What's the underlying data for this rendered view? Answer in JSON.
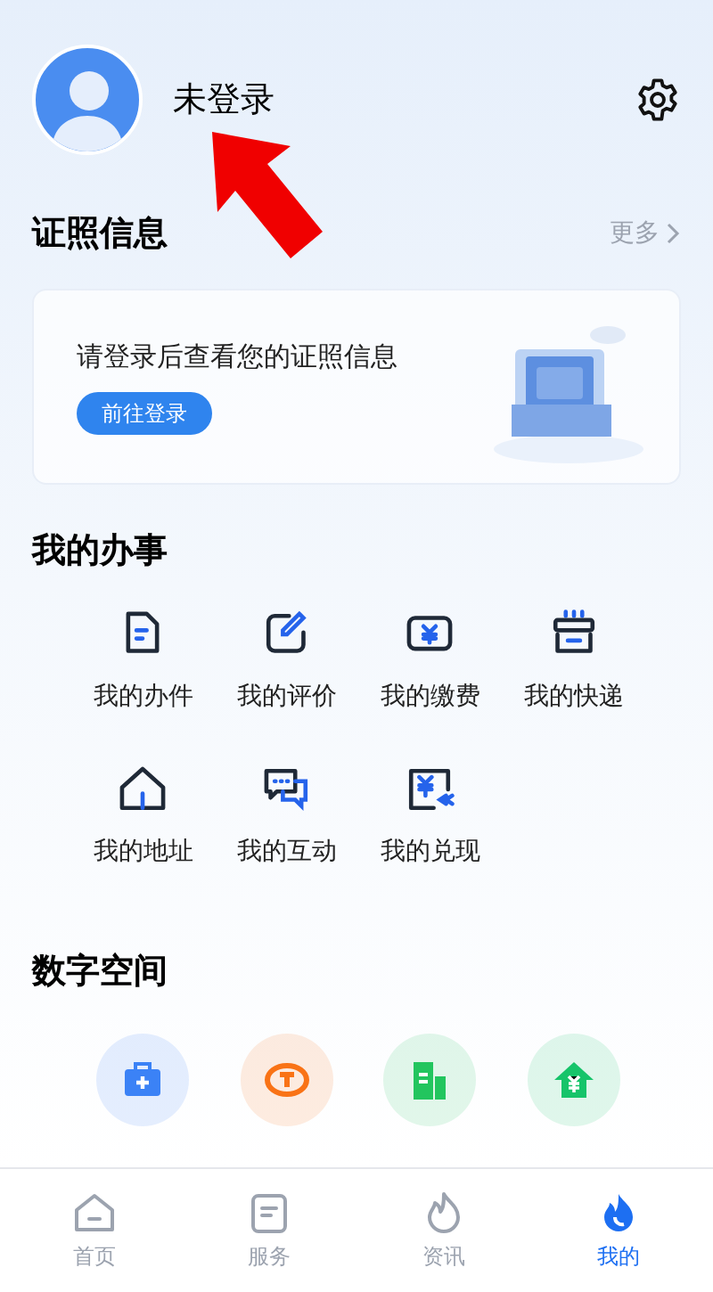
{
  "profile": {
    "name": "未登录"
  },
  "license": {
    "title": "证照信息",
    "more": "更多",
    "message": "请登录后查看您的证照信息",
    "login_button": "前往登录"
  },
  "affairs": {
    "title": "我的办事",
    "items": [
      {
        "label": "我的办件",
        "kind": "document"
      },
      {
        "label": "我的评价",
        "kind": "edit"
      },
      {
        "label": "我的缴费",
        "kind": "payment"
      },
      {
        "label": "我的快递",
        "kind": "parcel"
      },
      {
        "label": "我的地址",
        "kind": "house"
      },
      {
        "label": "我的互动",
        "kind": "chat"
      },
      {
        "label": "我的兑现",
        "kind": "cashout"
      }
    ]
  },
  "digital": {
    "title": "数字空间",
    "items": [
      {
        "kind": "medical",
        "color": "#3b82f6"
      },
      {
        "kind": "social",
        "color": "#f97316"
      },
      {
        "kind": "building",
        "color": "#22c55e"
      },
      {
        "kind": "fund",
        "color": "#16c46a"
      }
    ]
  },
  "tabs": [
    {
      "label": "首页",
      "kind": "home",
      "selected": false
    },
    {
      "label": "服务",
      "kind": "service",
      "selected": false
    },
    {
      "label": "资讯",
      "kind": "flame",
      "selected": false
    },
    {
      "label": "我的",
      "kind": "me",
      "selected": true
    }
  ]
}
